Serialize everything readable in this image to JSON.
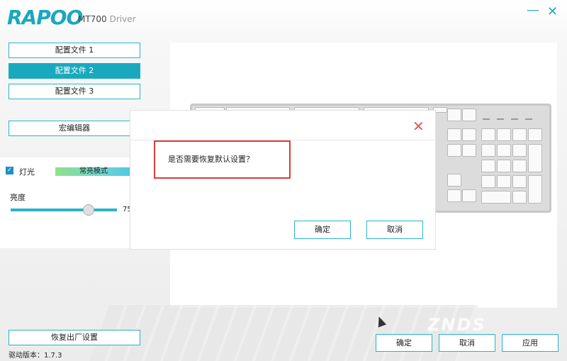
{
  "header": {
    "logo": "RAPOO",
    "model": "MT700",
    "driver_word": "Driver",
    "min_glyph": "—",
    "close_glyph": "✕"
  },
  "sidebar": {
    "profiles": [
      {
        "label": "配置文件 1",
        "active": false
      },
      {
        "label": "配置文件 2",
        "active": true
      },
      {
        "label": "配置文件 3",
        "active": false
      }
    ],
    "macro_editor": "宏编辑器"
  },
  "lighting": {
    "checked": true,
    "label": "灯光",
    "mode": "常亮模式",
    "brightness_label": "亮度",
    "brightness_value": "75"
  },
  "dialog": {
    "message": "是否需要恢复默认设置？",
    "confirm": "确定",
    "cancel": "取消",
    "close_glyph": "✕"
  },
  "footer": {
    "reset": "恢复出厂设置",
    "version": "驱动版本：1.7.3",
    "ok": "确定",
    "cancel": "取消",
    "apply": "应用"
  },
  "watermark": "ZNDS",
  "colors": {
    "accent": "#19a9bf",
    "dialog_highlight": "#d83d3d",
    "close_red": "#e05a4f"
  }
}
